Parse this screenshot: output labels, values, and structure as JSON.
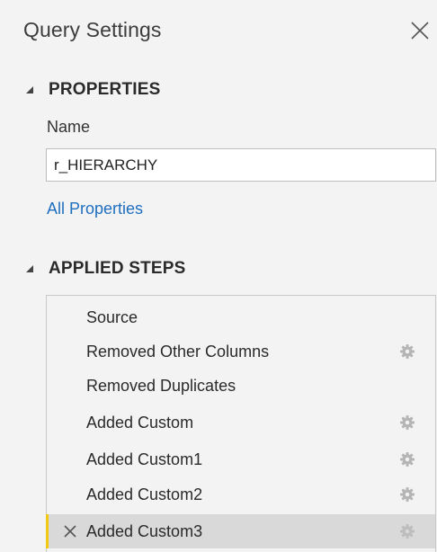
{
  "panel": {
    "title": "Query Settings",
    "close_icon": "close-icon"
  },
  "properties": {
    "heading": "PROPERTIES",
    "name_label": "Name",
    "name_value": "r_HIERARCHY",
    "all_properties_link": "All Properties"
  },
  "applied_steps": {
    "heading": "APPLIED STEPS",
    "steps": [
      {
        "label": "Source",
        "has_settings": false,
        "selected": false
      },
      {
        "label": "Removed Other Columns",
        "has_settings": true,
        "selected": false
      },
      {
        "label": "Removed Duplicates",
        "has_settings": false,
        "selected": false
      },
      {
        "label": "Added Custom",
        "has_settings": true,
        "selected": false
      },
      {
        "label": "Added Custom1",
        "has_settings": true,
        "selected": false
      },
      {
        "label": "Added Custom2",
        "has_settings": true,
        "selected": false
      },
      {
        "label": "Added Custom3",
        "has_settings": true,
        "selected": true
      }
    ]
  },
  "colors": {
    "link": "#1f6fbf",
    "selected_row": "#d9d9d9",
    "selected_accent": "#f2c811",
    "gear": "#b5b5b5"
  }
}
